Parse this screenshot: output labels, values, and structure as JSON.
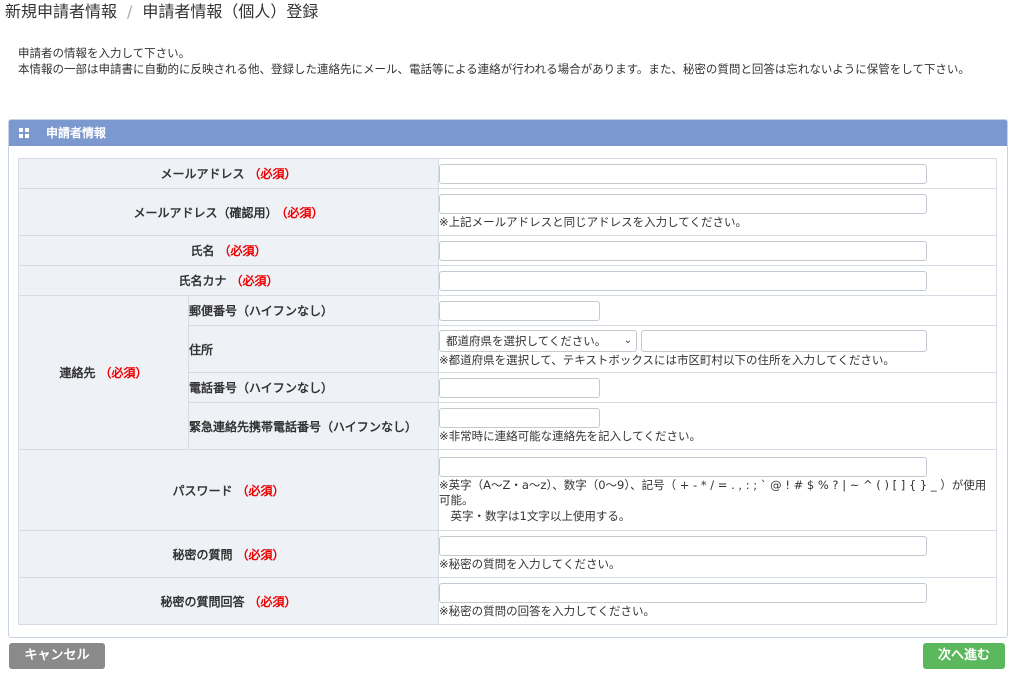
{
  "breadcrumb": {
    "first": "新規申請者情報",
    "separator": "/",
    "current": "申請者情報（個人）登録"
  },
  "intro": {
    "line1": "申請者の情報を入力して下さい。",
    "line2": "本情報の一部は申請書に自動的に反映される他、登録した連絡先にメール、電話等による連絡が行われる場合があります。また、秘密の質問と回答は忘れないように保管をして下さい。"
  },
  "panel": {
    "title": "申請者情報"
  },
  "required_mark": "（必須）",
  "fields": {
    "email": {
      "label": "メールアドレス",
      "value": ""
    },
    "email_confirm": {
      "label": "メールアドレス（確認用）",
      "value": "",
      "note": "※上記メールアドレスと同じアドレスを入力してください。"
    },
    "name": {
      "label": "氏名",
      "value": ""
    },
    "name_kana": {
      "label": "氏名カナ",
      "value": ""
    },
    "contact": {
      "label": "連絡先",
      "postal": {
        "label": "郵便番号（ハイフンなし）",
        "value": ""
      },
      "address": {
        "label": "住所",
        "select_value": "都道府県を選択してください。",
        "value": "",
        "note": "※都道府県を選択して、テキストボックスには市区町村以下の住所を入力してください。"
      },
      "phone": {
        "label": "電話番号（ハイフンなし）",
        "value": ""
      },
      "emergency": {
        "label": "緊急連絡先携帯電話番号（ハイフンなし）",
        "value": "",
        "note": "※非常時に連絡可能な連絡先を記入してください。"
      }
    },
    "password": {
      "label": "パスワード",
      "value": "",
      "note1": "※英字（A～Z・a～z）、数字（0～9）、記号（ + - * / = . , : ; ` @ ! # $ % ? | ~ ^ ( ) [ ] { } _ ）が使用可能。",
      "note2": "　英字・数字は1文字以上使用する。"
    },
    "secret_q": {
      "label": "秘密の質問",
      "value": "",
      "note": "※秘密の質問を入力してください。"
    },
    "secret_a": {
      "label": "秘密の質問回答",
      "value": "",
      "note": "※秘密の質問の回答を入力してください。"
    }
  },
  "buttons": {
    "cancel": "キャンセル",
    "next": "次へ進む"
  },
  "colors": {
    "panel_header": "#7b99cf",
    "required": "#e00000",
    "cancel": "#8a8a8a",
    "next": "#5cb85c",
    "label_bg": "#eef1f6"
  },
  "icons": {
    "panel": "grid-icon",
    "select": "chevron-down-icon"
  }
}
